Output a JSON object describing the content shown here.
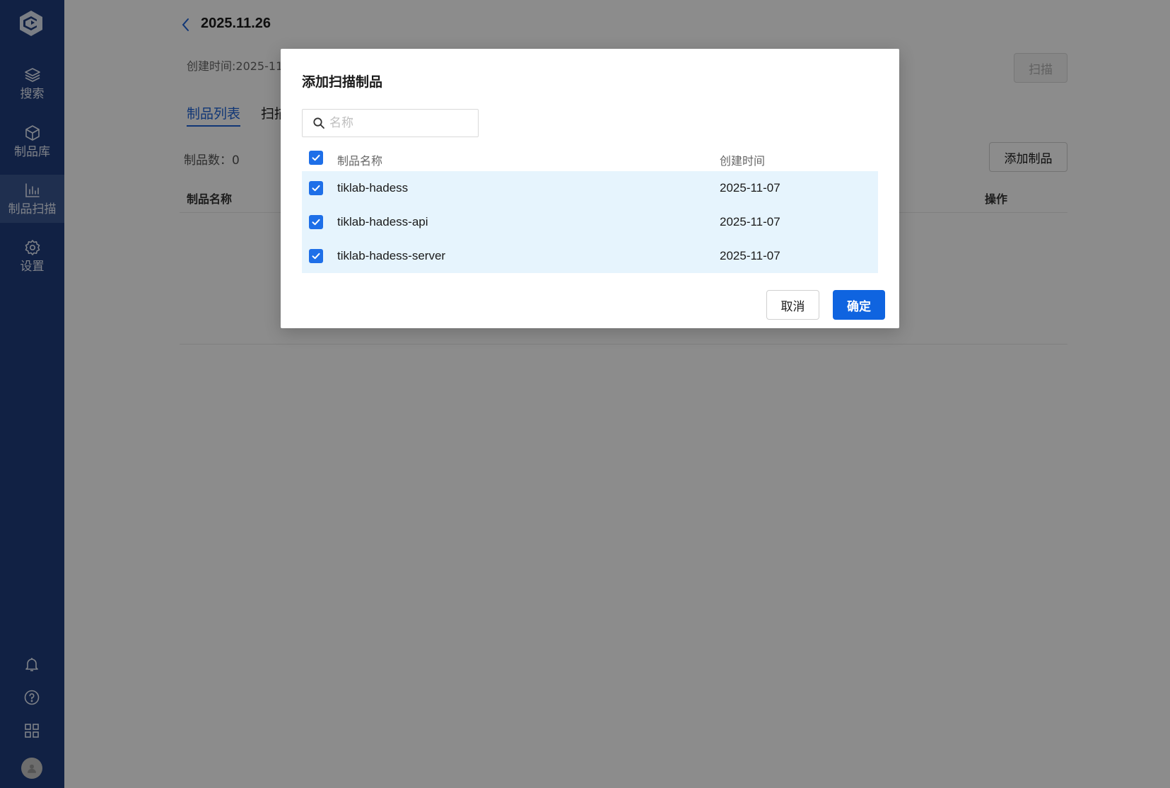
{
  "sidebar": {
    "logo_icon": "brand-logo-icon",
    "items": [
      {
        "label": "搜索",
        "icon": "layers-icon"
      },
      {
        "label": "制品库",
        "icon": "cube-icon"
      },
      {
        "label": "制品扫描",
        "icon": "bar-chart-icon",
        "active": true
      },
      {
        "label": "设置",
        "icon": "gear-icon"
      }
    ],
    "bottom_icons": [
      "bell-icon",
      "help-icon",
      "grid-icon",
      "avatar"
    ]
  },
  "header": {
    "title": "2025.11.26",
    "created_label": "创建时间:2025-11",
    "scan_button": "扫描"
  },
  "tabs": [
    {
      "label": "制品列表",
      "active": true
    },
    {
      "label": "扫描"
    }
  ],
  "list": {
    "count_label": "制品数：0",
    "add_button": "添加制品",
    "columns": {
      "name": "制品名称",
      "operation": "操作"
    }
  },
  "modal": {
    "title": "添加扫描制品",
    "search": {
      "placeholder": "名称",
      "value": ""
    },
    "columns": {
      "name": "制品名称",
      "created": "创建时间"
    },
    "rows": [
      {
        "name": "tiklab-hadess",
        "created": "2025-11-07",
        "checked": true
      },
      {
        "name": "tiklab-hadess-api",
        "created": "2025-11-07",
        "checked": true
      },
      {
        "name": "tiklab-hadess-server",
        "created": "2025-11-07",
        "checked": true
      }
    ],
    "select_all_checked": true,
    "cancel_button": "取消",
    "ok_button": "确定"
  },
  "colors": {
    "sidebar_bg": "#203d7c",
    "sidebar_active": "#3a5791",
    "primary": "#0f64e0",
    "row_highlight": "#e6f4fd"
  }
}
